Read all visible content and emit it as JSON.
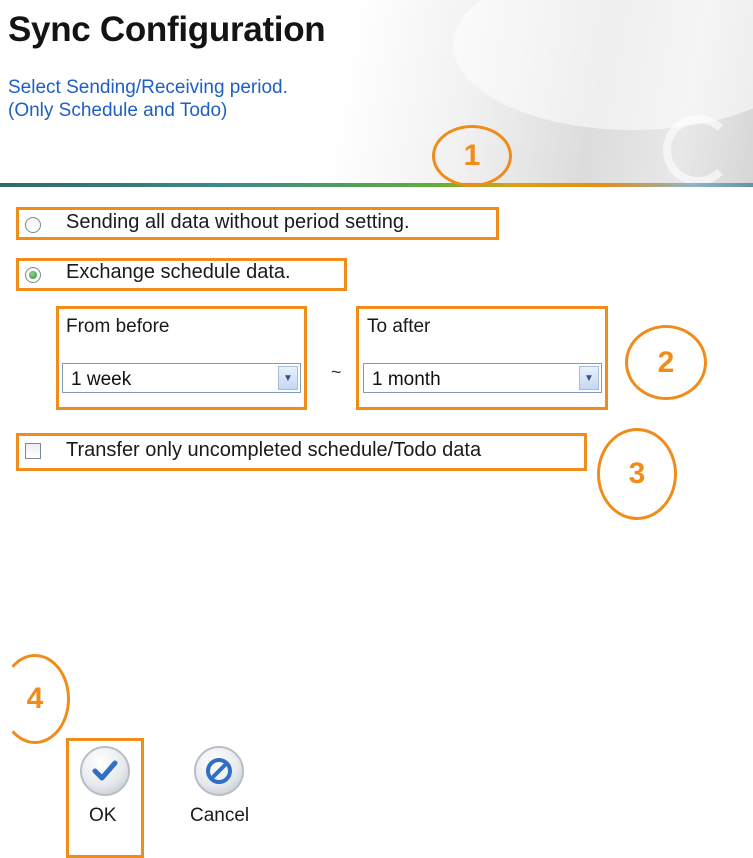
{
  "header": {
    "title": "Sync Configuration",
    "subtitle_line1": "Select Sending/Receiving period.",
    "subtitle_line2": "(Only Schedule and Todo)"
  },
  "options": {
    "send_all_label": "Sending all data without period setting.",
    "exchange_label": "Exchange schedule data.",
    "selected": "exchange"
  },
  "period": {
    "from_label": "From before",
    "from_value": "1 week",
    "separator": "~",
    "to_label": "To after",
    "to_value": "1 month"
  },
  "uncompleted": {
    "label": "Transfer only uncompleted schedule/Todo data",
    "checked": false
  },
  "buttons": {
    "ok_label": "OK",
    "cancel_label": "Cancel"
  },
  "callouts": [
    "1",
    "2",
    "3",
    "4"
  ],
  "colors": {
    "highlight": "#f08c1a",
    "subtitle": "#1f5fc2",
    "ok_icon": "#2f6fc4",
    "cancel_icon": "#2f6fc4"
  },
  "icons": {
    "dropdown": "chevron-down-icon",
    "ok": "checkmark-icon",
    "cancel": "prohibited-icon"
  }
}
